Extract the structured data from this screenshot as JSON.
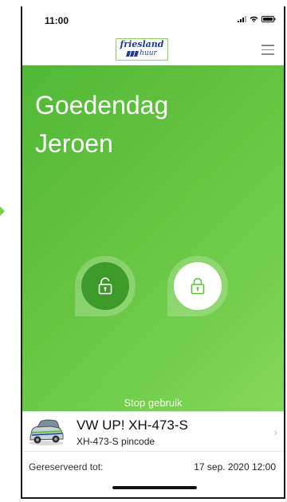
{
  "status_bar": {
    "time": "11:00",
    "icons": [
      "cellular-signal-icon",
      "wifi-icon",
      "battery-icon"
    ]
  },
  "header": {
    "logo_top": "friesland",
    "logo_bottom": "huur",
    "menu_icon": "hamburger-menu-icon"
  },
  "greeting": {
    "line1": "Goedendag",
    "line2": "Jeroen"
  },
  "controls": {
    "unlock_icon": "unlock-icon",
    "lock_icon": "lock-icon",
    "stop_label": "Stop gebruik"
  },
  "vehicle": {
    "name": "VW UP! XH-473-S",
    "pincode_label": "XH-473-S pincode",
    "chevron": "›"
  },
  "reservation": {
    "label": "Gereserveerd tot:",
    "value": "17 sep. 2020 12:00"
  },
  "colors": {
    "accent_green": "#5fbf3d",
    "dark_green": "#3f9a2c",
    "brand_blue": "#1e3f8f"
  }
}
